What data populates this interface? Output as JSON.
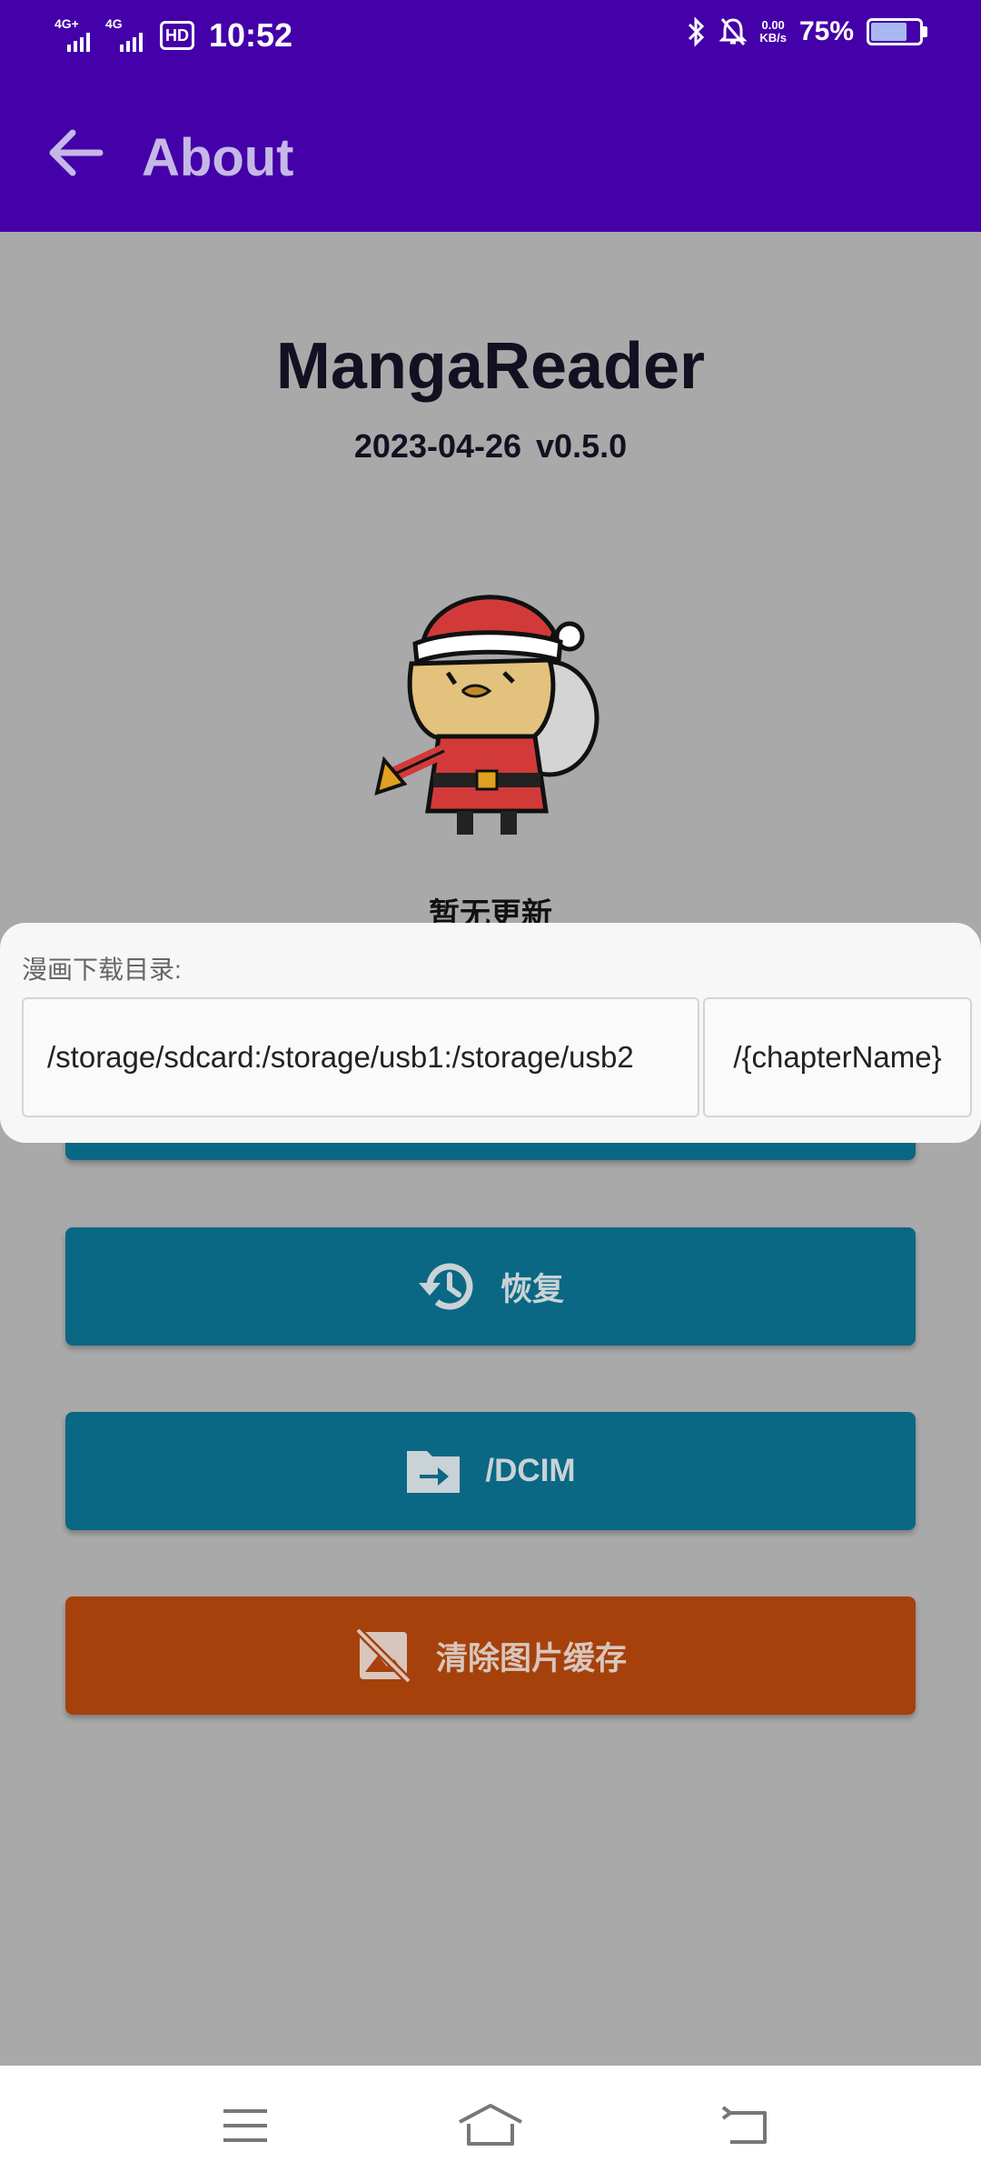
{
  "status_bar": {
    "time": "10:52",
    "network_1": "4G+",
    "network_2": "4G",
    "hd_badge": "HD",
    "net_speed_value": "0.00",
    "net_speed_unit": "KB/s",
    "battery_percent": "75%",
    "battery_level": 0.75
  },
  "app_bar": {
    "title": "About",
    "back_icon": "arrow-back-icon",
    "background_color": "#4400a9"
  },
  "about": {
    "app_name": "MangaReader",
    "version_line": "2023-04-26  v0.5.0",
    "mascot_icon": "santa-mascot-icon",
    "update_status": "暂无更新"
  },
  "buttons": [
    {
      "label": "",
      "icon": "hidden-button",
      "color": "#0a6884"
    },
    {
      "label": "恢复",
      "icon": "history-icon",
      "color": "#0a6884"
    },
    {
      "label": "/DCIM",
      "icon": "folder-move-icon",
      "color": "#0a6884"
    },
    {
      "label": "清除图片缓存",
      "icon": "image-off-icon",
      "color": "#a6410c"
    }
  ],
  "download_dir_popup": {
    "label": "漫画下载目录:",
    "path_value": "/storage/sdcard:/storage/usb1:/storage/usb2",
    "suffix_value": "/{chapterName}"
  },
  "nav_bar": {
    "menu_icon": "menu-icon",
    "home_icon": "home-icon",
    "back_icon": "back-icon"
  }
}
